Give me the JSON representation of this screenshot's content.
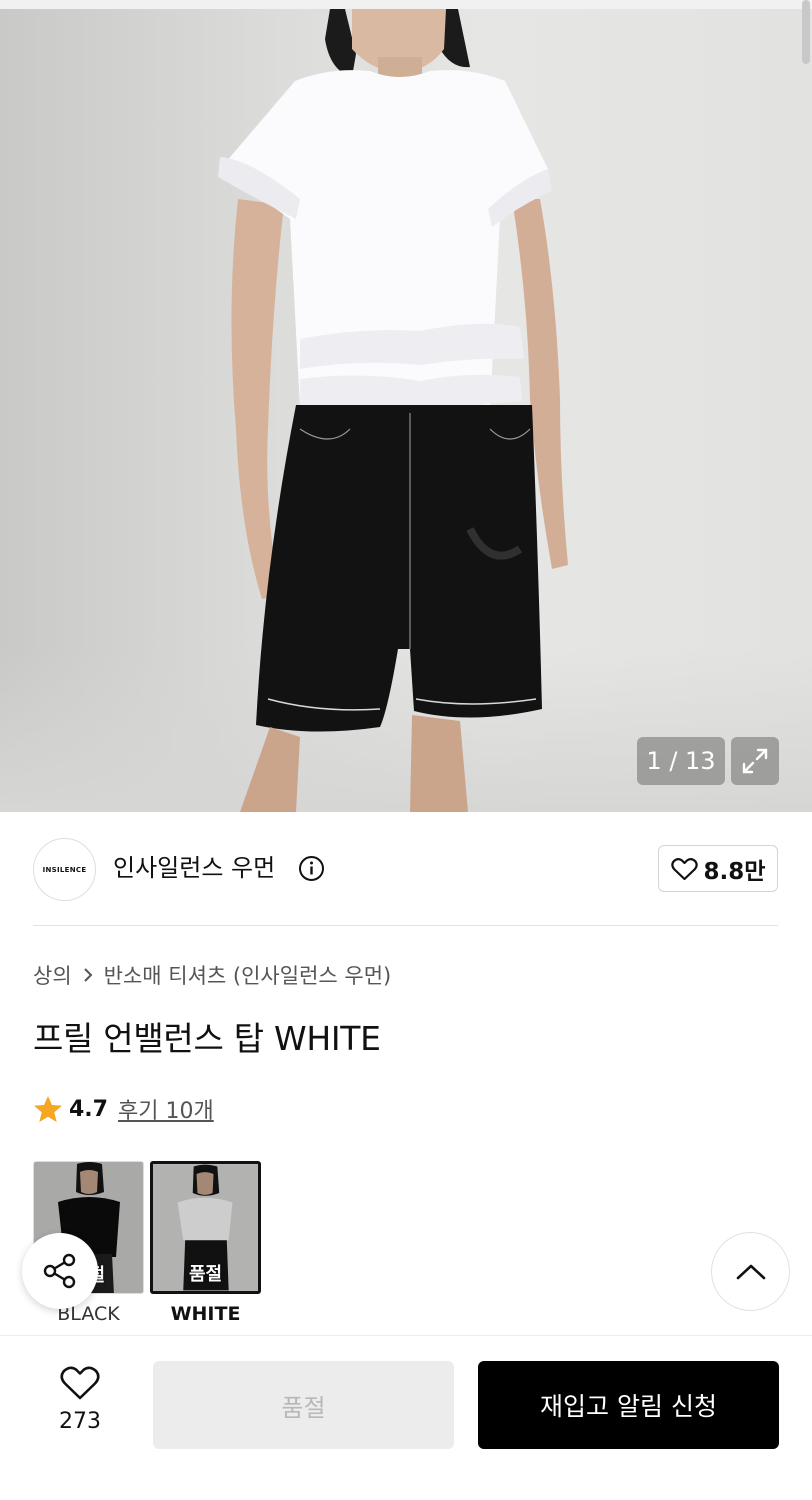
{
  "gallery": {
    "counter": "1 / 13"
  },
  "brand": {
    "logo_text": "INSILENCE",
    "name": "인사일런스 우먼",
    "likes": "8.8만"
  },
  "breadcrumb": {
    "category": "상의",
    "subcategory": "반소매 티셔츠 (인사일런스 우먼)"
  },
  "product": {
    "title": "프릴 언밸런스 탑 WHITE",
    "rating": "4.7",
    "reviews": "후기 10개"
  },
  "colors": [
    {
      "label": "BLACK",
      "badge": "품절",
      "selected": false
    },
    {
      "label": "WHITE",
      "badge": "품절",
      "selected": true
    }
  ],
  "bottom_bar": {
    "wish_count": "273",
    "soldout_label": "품절",
    "restock_label": "재입고 알림 신청"
  },
  "theme": {
    "accent": "#000000",
    "star": "#f5a623"
  }
}
